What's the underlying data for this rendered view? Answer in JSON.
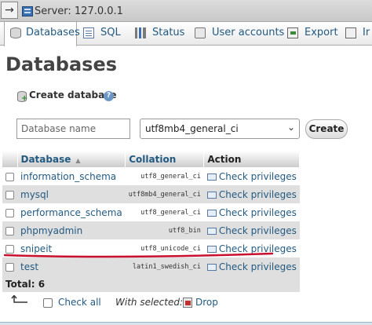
{
  "breadcrumb": {
    "collapse_glyph": "→",
    "server_label": "Server: 127.0.0.1"
  },
  "tabs": [
    {
      "label": "Databases",
      "icon": "database-icon",
      "active": true
    },
    {
      "label": "SQL",
      "icon": "sql-icon",
      "active": false
    },
    {
      "label": "Status",
      "icon": "status-icon",
      "active": false
    },
    {
      "label": "User accounts",
      "icon": "users-icon",
      "active": false
    },
    {
      "label": "Export",
      "icon": "export-icon",
      "active": false
    },
    {
      "label": "Ir",
      "icon": "import-icon",
      "active": false
    }
  ],
  "page_title": "Databases",
  "create_database": {
    "label": "Create database",
    "help_glyph": "?",
    "name_placeholder": "Database name",
    "collation_value": "utf8mb4_general_ci",
    "button_label": "Create"
  },
  "table": {
    "headers": {
      "database": "Database",
      "collation": "Collation",
      "action": "Action"
    },
    "rows": [
      {
        "name": "information_schema",
        "collation": "utf8_general_ci",
        "action": "Check privileges"
      },
      {
        "name": "mysql",
        "collation": "utf8mb4_general_ci",
        "action": "Check privileges"
      },
      {
        "name": "performance_schema",
        "collation": "utf8_general_ci",
        "action": "Check privileges"
      },
      {
        "name": "phpmyadmin",
        "collation": "utf8_bin",
        "action": "Check privileges"
      },
      {
        "name": "snipeit",
        "collation": "utf8_unicode_ci",
        "action": "Check privileges"
      },
      {
        "name": "test",
        "collation": "latin1_swedish_ci",
        "action": "Check privileges"
      }
    ],
    "total_label": "Total: 6"
  },
  "footer": {
    "check_all_label": "Check all",
    "with_selected_label": "With selected:",
    "drop_label": "Drop"
  },
  "colors": {
    "link": "#235a81",
    "annotation": "#c8102e"
  }
}
